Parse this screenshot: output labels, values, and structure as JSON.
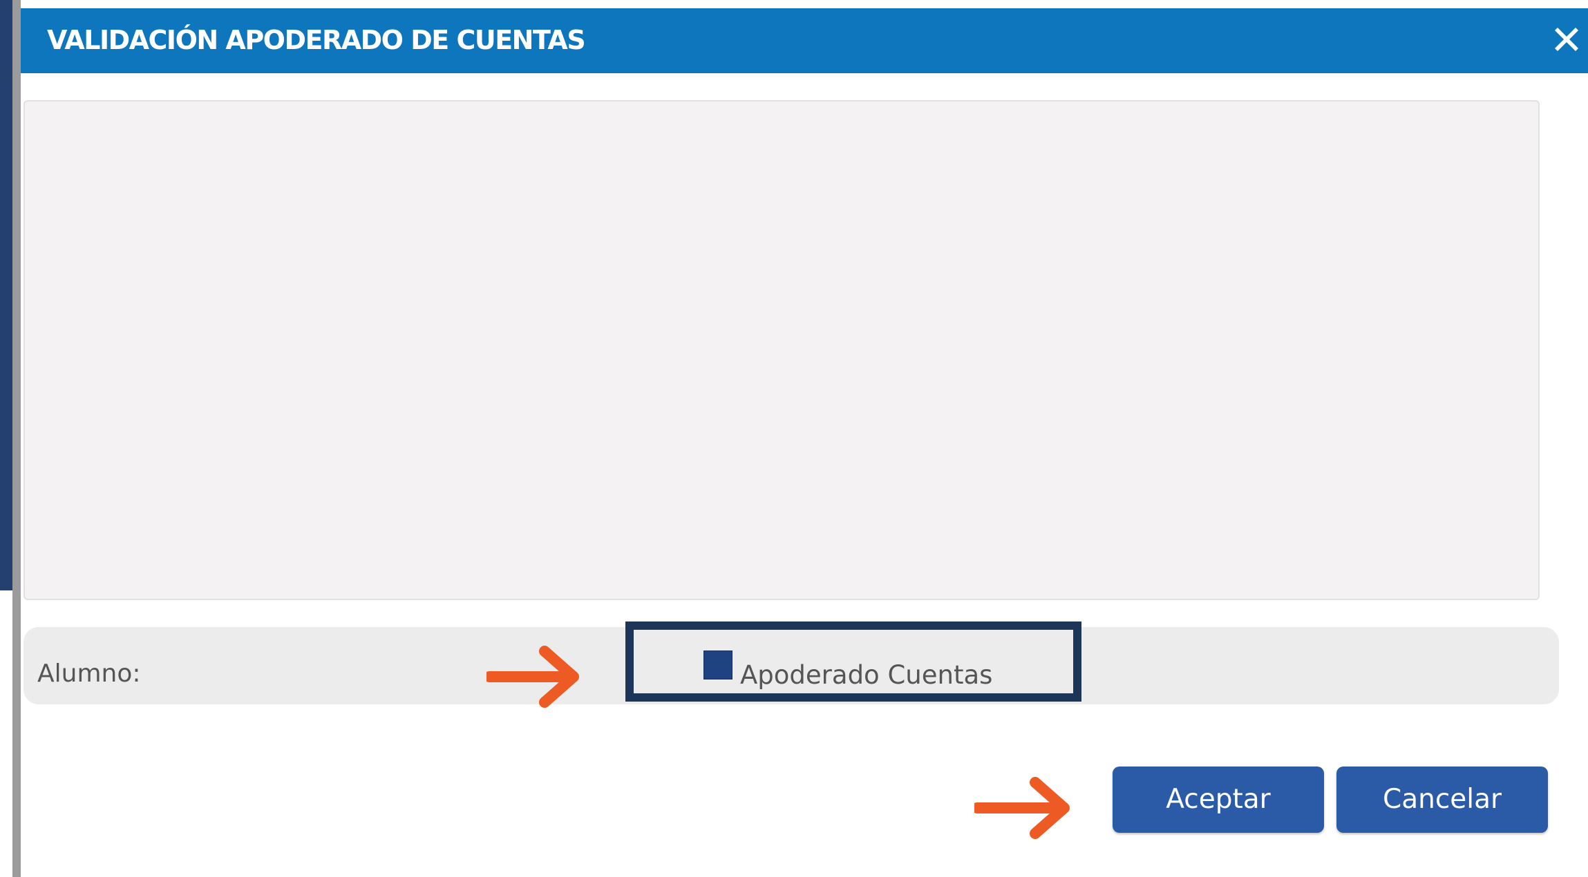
{
  "dialog": {
    "title": "VALIDACIÓN APODERADO DE CUENTAS",
    "close_icon": "close-icon"
  },
  "form": {
    "alumno_label": "Alumno:",
    "checkbox_label": "Apoderado Cuentas",
    "checkbox_checked": true
  },
  "actions": {
    "accept_label": "Aceptar",
    "cancel_label": "Cancelar"
  },
  "annotations": {
    "arrow_icon": "arrow-right-icon",
    "highlight_color": "#1d3557"
  },
  "colors": {
    "titlebar": "#0d76bd",
    "button": "#2b5aa6",
    "annotation_arrow": "#ee5a24",
    "checkbox_fill": "#1f4281"
  }
}
